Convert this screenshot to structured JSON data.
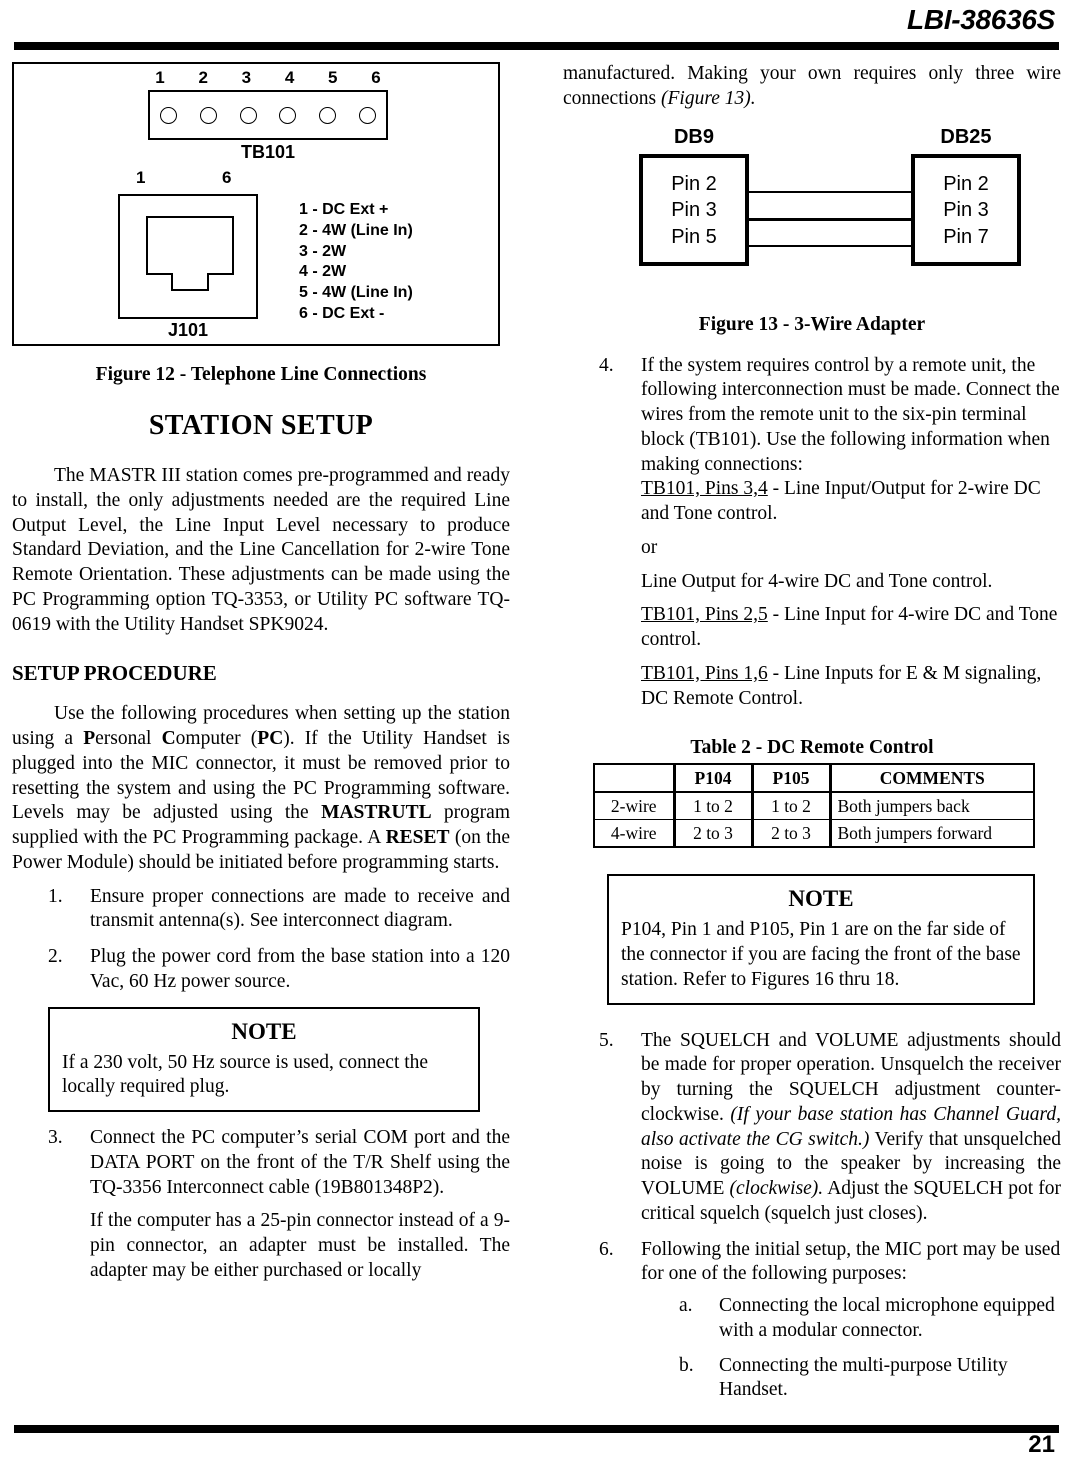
{
  "header": {
    "document_code": "LBI-38636S"
  },
  "footer": {
    "page_number": "21"
  },
  "figure12": {
    "caption": "Figure 12 - Telephone Line Connections",
    "tb101_label": "TB101",
    "tb101_pins": [
      "1",
      "2",
      "3",
      "4",
      "5",
      "6"
    ],
    "j101_label": "J101",
    "j101_left_pin": "1",
    "j101_right_pin": "6",
    "pin_legend": [
      "1 - DC Ext +",
      "2 - 4W (Line In)",
      "3 - 2W",
      "4 - 2W",
      "5 - 4W (Line In)",
      "6 - DC Ext -"
    ]
  },
  "station_setup": {
    "title": "STATION SETUP",
    "intro": "The MASTR III station comes pre-programmed and ready to install, the only adjustments needed are the required Line Output Level, the Line Input Level necessary to produce Standard Deviation, and the Line Cancellation for 2-wire Tone Remote Orientation. These adjustments can be made using the PC Programming option TQ-3353, or Utility PC software TQ-0619 with the Utility Handset SPK9024."
  },
  "setup_procedure": {
    "title": "SETUP PROCEDURE",
    "intro_part1": "Use the following procedures when setting up the station using a ",
    "intro_bold_p": "P",
    "intro_part2": "ersonal ",
    "intro_bold_c": "C",
    "intro_part3": "omputer (",
    "intro_bold_pc": "PC",
    "intro_part4": "). If the Utility Handset is plugged into the MIC connector, it must be removed prior to resetting the system and using the PC Programming software. Levels may be adjusted using the ",
    "intro_bold_mastrutl": "MASTRUTL",
    "intro_part5": " program supplied with the PC Programming package. A ",
    "intro_bold_reset": "RESET",
    "intro_part6": " (on the Power Module) should be initiated before programming starts.",
    "steps": [
      {
        "num": "1.",
        "text": "Ensure proper connections are made to receive and transmit antenna(s). See interconnect diagram."
      },
      {
        "num": "2.",
        "text": "Plug the power cord from the base station into a 120 Vac, 60 Hz power source."
      },
      {
        "num": "3.",
        "text": "Connect the PC computer’s serial COM port and the DATA PORT on the front of the T/R Shelf using the TQ-3356 Interconnect cable (19B801348P2).",
        "sub": "If the computer has a 25-pin connector instead of a 9-pin connector, an adapter must be installed. The adapter may be either purchased or locally"
      }
    ]
  },
  "note_left": {
    "title": "NOTE",
    "body": "If a 230 volt, 50 Hz source is used, connect the locally required plug."
  },
  "right_column": {
    "continuation": "manufactured. Making your own requires only three wire connections ",
    "continuation_italic": "(Figure 13)."
  },
  "figure13": {
    "caption": "Figure 13 - 3-Wire Adapter",
    "left_header": "DB9",
    "right_header": "DB25",
    "left_pins": [
      "Pin 2",
      "Pin 3",
      "Pin 5"
    ],
    "right_pins": [
      "Pin 2",
      "Pin 3",
      "Pin 7"
    ]
  },
  "step4": {
    "num": "4.",
    "text": "If the system requires control by a remote unit, the following interconnection must be made. Connect the wires from the remote unit to the six-pin terminal block (TB101). Use the following information when making connections:",
    "line1_underlined": "TB101, Pins 3,4",
    "line1_rest": " - Line Input/Output for 2-wire DC and Tone control.",
    "or_text": "or",
    "line2": "Line Output for 4-wire DC and Tone control.",
    "line3_underlined": "TB101, Pins 2,5",
    "line3_rest": " - Line Input for 4-wire DC and Tone control.",
    "line4_underlined": "TB101, Pins 1,6",
    "line4_rest": " - Line Inputs for E & M signaling, DC Remote Control."
  },
  "table2": {
    "caption": "Table 2 - DC Remote Control",
    "columns": [
      "",
      "P104",
      "P105",
      "COMMENTS"
    ],
    "rows": [
      [
        "2-wire",
        "1 to 2",
        "1 to 2",
        "Both jumpers back"
      ],
      [
        "4-wire",
        "2 to 3",
        "2 to 3",
        "Both jumpers forward"
      ]
    ]
  },
  "note_right": {
    "title": "NOTE",
    "body": "P104, Pin 1 and P105, Pin 1 are on the far side of the connector if you are facing the front of the base station. Refer to Figures 16 thru 18."
  },
  "step5": {
    "num": "5.",
    "part1": "The SQUELCH and VOLUME adjustments should be made for proper operation. Unsquelch the receiver by turning the SQUELCH adjustment counter-clockwise. ",
    "italic1": "(If your base station has Channel Guard, also activate the CG switch.)",
    "part2": " Verify that unsquelched noise is going to the speaker by increasing the VOLUME ",
    "italic2": "(clockwise).",
    "part3": " Adjust the SQUELCH pot for critical squelch (squelch just closes)."
  },
  "step6": {
    "num": "6.",
    "text": "Following the initial setup, the MIC port may be used for one of the following purposes:",
    "sub_items": [
      {
        "ltr": "a.",
        "text": "Connecting the local microphone equipped with a modular connector."
      },
      {
        "ltr": "b.",
        "text": "Connecting the multi-purpose Utility Handset."
      }
    ]
  }
}
